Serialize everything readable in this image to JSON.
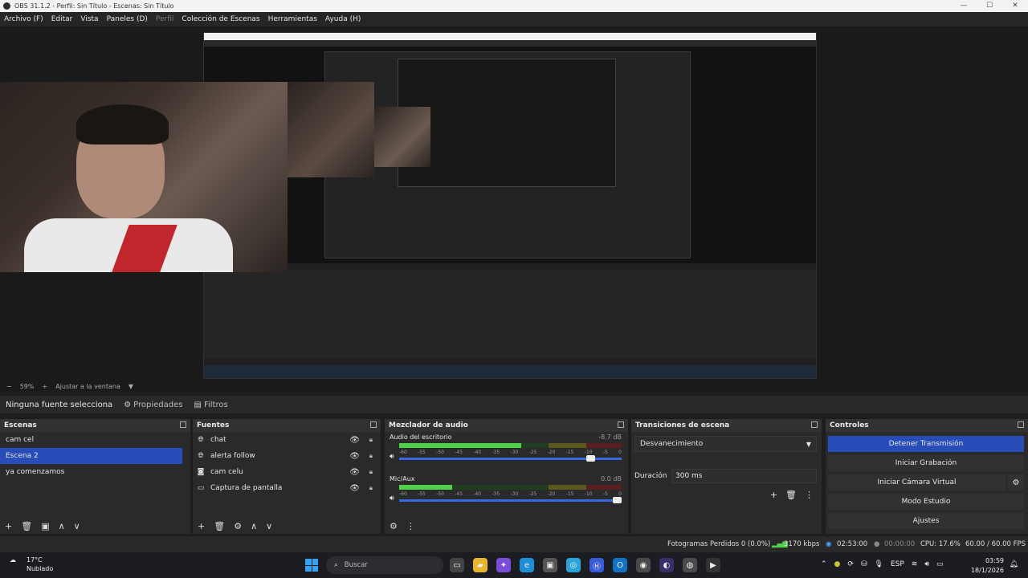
{
  "window": {
    "title": "OBS 31.1.2 - Perfil: Sin Título - Escenas: Sin Título",
    "buttons": [
      "—",
      "☐",
      "✕"
    ]
  },
  "menu": [
    {
      "label": "Archivo (F)",
      "enabled": true
    },
    {
      "label": "Editar",
      "enabled": true
    },
    {
      "label": "Vista",
      "enabled": true
    },
    {
      "label": "Paneles (D)",
      "enabled": true
    },
    {
      "label": "Perfil",
      "enabled": false
    },
    {
      "label": "Colección de Escenas",
      "enabled": true
    },
    {
      "label": "Herramientas",
      "enabled": true
    },
    {
      "label": "Ayuda (H)",
      "enabled": true
    }
  ],
  "zoom": {
    "minus": "−",
    "value": "59%",
    "plus": "+",
    "fit_label": "Ajustar a la ventana",
    "dropdown": "▼"
  },
  "source_toolbar": {
    "no_source": "Ninguna fuente selecciona",
    "properties": "Propiedades",
    "filters": "Filtros"
  },
  "scenes": {
    "title": "Escenas",
    "items": [
      {
        "label": "cam cel",
        "selected": false
      },
      {
        "label": "Escena 2",
        "selected": true
      },
      {
        "label": "ya comenzamos",
        "selected": false
      }
    ],
    "footer": [
      "+",
      "🗑",
      "▣",
      "∧",
      "∨"
    ]
  },
  "sources": {
    "title": "Fuentes",
    "items": [
      {
        "label": "chat",
        "icon": "browser-icon"
      },
      {
        "label": "alerta follow",
        "icon": "browser-icon"
      },
      {
        "label": "cam celu",
        "icon": "camera-icon"
      },
      {
        "label": "Captura de pantalla",
        "icon": "display-capture-icon"
      }
    ],
    "footer": [
      "+",
      "🗑",
      "⚙",
      "∧",
      "∨"
    ]
  },
  "mixer": {
    "title": "Mezclador de audio",
    "channels": [
      {
        "name": "Audio del escritorio",
        "db": "-8.7 dB",
        "level": 0.55,
        "volume": 0.88
      },
      {
        "name": "Mic/Aux",
        "db": "0.0 dB",
        "level": 0.24,
        "volume": 1.0
      }
    ],
    "ticks": [
      "-60",
      "-55",
      "-50",
      "-45",
      "-40",
      "-35",
      "-30",
      "-25",
      "-20",
      "-15",
      "-10",
      "-5",
      "0"
    ],
    "footer": [
      "⚙",
      "⋮"
    ]
  },
  "transitions": {
    "title": "Transiciones de escena",
    "selected": "Desvanecimiento",
    "duration_label": "Duración",
    "duration_value": "300 ms"
  },
  "controls": {
    "title": "Controles",
    "buttons": [
      "Detener Transmisión",
      "Iniciar Grabación",
      "Iniciar Cámara Virtual",
      "Modo Estudio",
      "Ajustes"
    ]
  },
  "status": {
    "dropped": "Fotogramas Perdidos 0 (0.0%)",
    "bitrate": "3170 kbps",
    "stream_time": "02:53:00",
    "rec_time": "00:00:00",
    "cpu": "CPU: 17.6%",
    "fps": "60.00 / 60.00 FPS"
  },
  "taskbar": {
    "temp": "17°C",
    "weather": "Nublado",
    "search": "Buscar",
    "lang": "ESP",
    "time": "03:59",
    "date": "18/1/2026"
  },
  "colors": {
    "accent": "#284cb8",
    "meter_green": "#4fd14a",
    "slider_blue": "#3868e0"
  }
}
